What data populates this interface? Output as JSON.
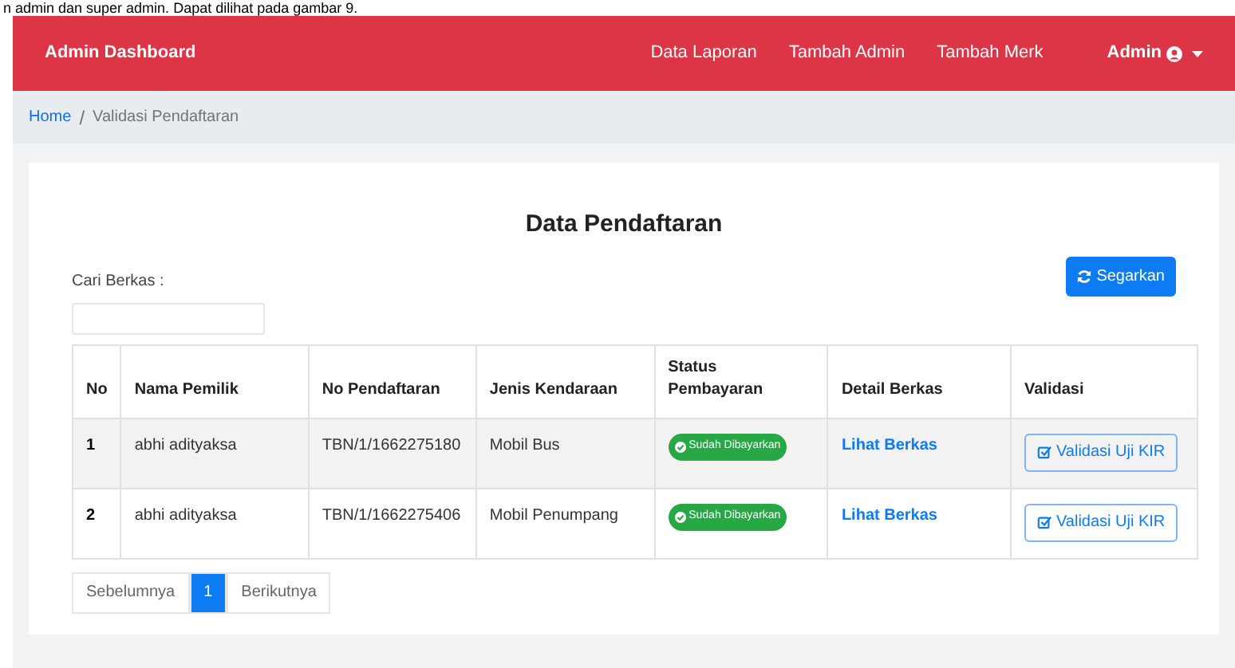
{
  "document_text": "n admin dan super admin. Dapat dilihat pada gambar 9.",
  "navbar": {
    "brand": "Admin Dashboard",
    "links": [
      "Data Laporan",
      "Tambah Admin",
      "Tambah Merk"
    ],
    "user": "Admin"
  },
  "breadcrumb_separator": "/",
  "breadcrumb": [
    {
      "label": "Home",
      "kind": "link"
    },
    {
      "label": "Validasi Pendaftaran",
      "kind": "current"
    }
  ],
  "card": {
    "title": "Data Pendaftaran",
    "search_label": "Cari Berkas :",
    "refresh_button": "Segarkan"
  },
  "table": {
    "columns": [
      "No",
      "Nama Pemilik",
      "No Pendaftaran",
      "Jenis Kendaraan",
      "Status Pembayaran",
      "Detail Berkas",
      "Validasi"
    ],
    "rows": [
      {
        "no": "1",
        "owner": "abhi adityaksa",
        "reg_no": "TBN/1/1662275180",
        "vehicle": "Mobil Bus",
        "status": "Sudah Dibayarkan",
        "detail": "Lihat Berkas",
        "action": "Validasi Uji KIR"
      },
      {
        "no": "2",
        "owner": "abhi adityaksa",
        "reg_no": "TBN/1/1662275406",
        "vehicle": "Mobil Penumpang",
        "status": "Sudah Dibayarkan",
        "detail": "Lihat Berkas",
        "action": "Validasi Uji KIR"
      }
    ]
  },
  "pagination": [
    {
      "label": "Sebelumnya",
      "selected": false
    },
    {
      "label": "1",
      "selected": true
    },
    {
      "label": "Berikutnya",
      "selected": false
    }
  ]
}
